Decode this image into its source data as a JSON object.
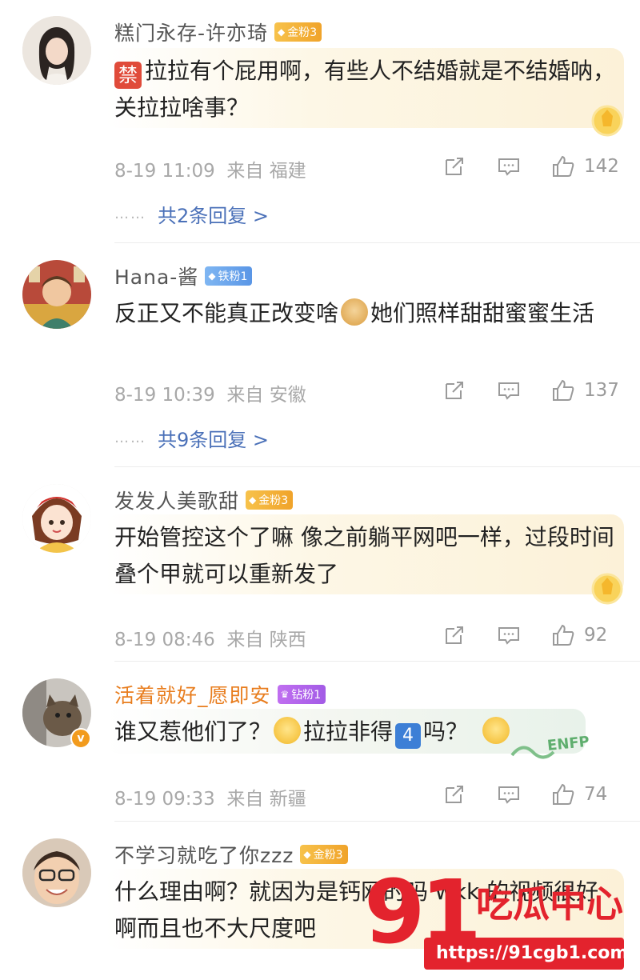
{
  "comments": [
    {
      "username": "糕门永存-许亦琦",
      "badge": "金粉3",
      "ban_tag": "禁",
      "text": "拉拉有个屁用啊，有些人不结婚就是不结婚呐，关拉拉啥事？",
      "time": "8-19 11:09",
      "location": "来自 福建",
      "likes": "142",
      "replies": "共2条回复 >"
    },
    {
      "username": "Hana-酱",
      "badge": "铁粉1",
      "text_before": "反正又不能真正改变啥",
      "text_after": "她们照样甜甜蜜蜜生活",
      "time": "8-19 10:39",
      "location": "来自 安徽",
      "likes": "137",
      "replies": "共9条回复 >"
    },
    {
      "username": "发发人美歌甜",
      "badge": "金粉3",
      "text": "开始管控这个了嘛 像之前躺平网吧一样，过段时间叠个甲就可以重新发了",
      "time": "8-19 08:46",
      "location": "来自 陕西",
      "likes": "92"
    },
    {
      "username": "活着就好_愿即安",
      "badge": "钻粉1",
      "verified_mark": "v",
      "text_before": "谁又惹他们了？",
      "text_mid": "拉拉非得",
      "num_tag": "4",
      "text_after": "吗？",
      "sticker": "ENFP",
      "time": "8-19 09:33",
      "location": "来自 新疆",
      "likes": "74"
    },
    {
      "username": "不学习就吃了你zzz",
      "badge": "金粉3",
      "text": "什么理由啊？就因为是钙网的吗 wkk 的视频很好啊而且也不大尺度吧"
    }
  ],
  "dots": "……",
  "watermark": {
    "number": "91",
    "title": "吃瓜中心",
    "url": "https://91cgb1.com"
  },
  "icon_names": [
    "share-icon",
    "comment-icon",
    "like-icon"
  ],
  "colors": {
    "reply_link": "#4a70b8",
    "gold_badge": "#f0a32a",
    "iron_badge": "#5a96e6",
    "diamond_badge": "#a35be6",
    "watermark_red": "#e3232d"
  }
}
